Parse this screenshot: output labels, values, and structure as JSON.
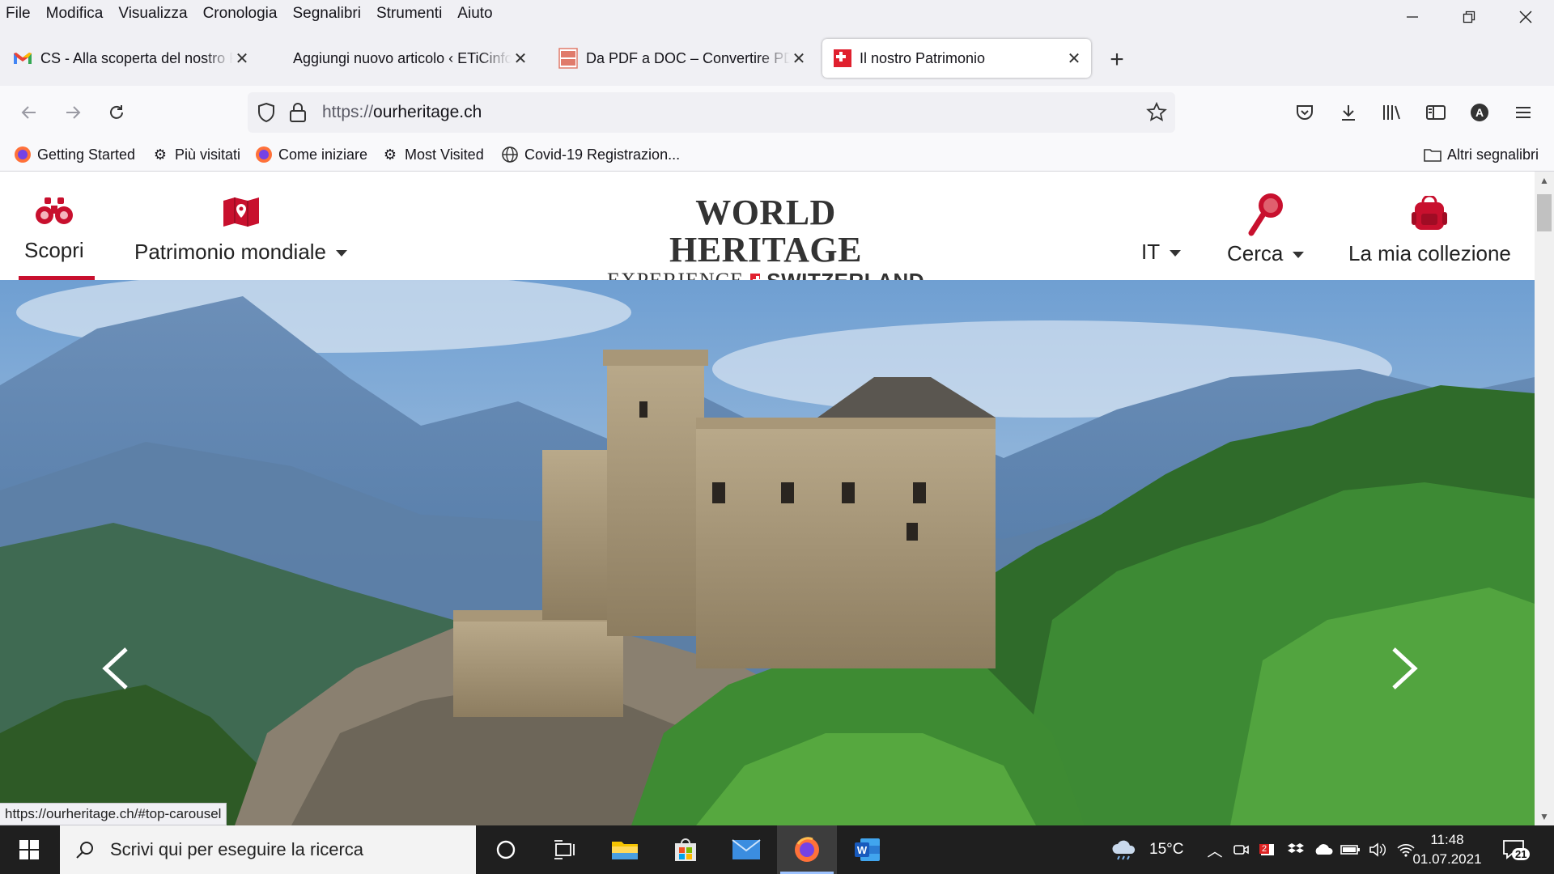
{
  "menu": [
    "File",
    "Modifica",
    "Visualizza",
    "Cronologia",
    "Segnalibri",
    "Strumenti",
    "Aiuto"
  ],
  "tabs": [
    {
      "label": "CS - Alla scoperta del nostro Patrimonio",
      "icon": "gmail-icon",
      "active": false
    },
    {
      "label": "Aggiungi nuovo articolo ‹ ETiCinforma",
      "icon": "wordpress-icon",
      "active": false
    },
    {
      "label": "Da PDF a DOC – Convertire PDF",
      "icon": "pdf-doc-icon",
      "active": false
    },
    {
      "label": "Il nostro Patrimonio",
      "icon": "swiss-flag-icon",
      "active": true
    }
  ],
  "url": {
    "protocol": "https://",
    "host": "ourheritage.ch"
  },
  "bookmarks": [
    {
      "label": "Getting Started",
      "icon": "firefox-icon"
    },
    {
      "label": "Più visitati",
      "icon": "gear-icon"
    },
    {
      "label": "Come iniziare",
      "icon": "firefox-icon"
    },
    {
      "label": "Most Visited",
      "icon": "gear-icon"
    },
    {
      "label": "Covid-19 Registrazion...",
      "icon": "globe-icon"
    }
  ],
  "other_bookmarks": "Altri segnalibri",
  "site": {
    "nav_left": [
      {
        "label": "Scopri",
        "icon": "binoculars-icon"
      },
      {
        "label": "Patrimonio mondiale",
        "icon": "map-pin-icon"
      }
    ],
    "logo_line1": "WORLD HERITAGE",
    "logo_line2_a": "EXPERIENCE",
    "logo_line2_b": "SWITZERLAND",
    "lang": "IT",
    "search": "Cerca",
    "collection": "La mia collezione"
  },
  "status_url": "https://ourheritage.ch/#top-carousel",
  "taskbar": {
    "search_placeholder": "Scrivi qui per eseguire la ricerca",
    "weather": "15°C",
    "time": "11:48",
    "date": "01.07.2021",
    "notifications": "21",
    "mail_badge": "2"
  },
  "colors": {
    "brand_red": "#c8102e",
    "taskbar": "#1f1f1f",
    "chrome": "#f0f0f4"
  }
}
